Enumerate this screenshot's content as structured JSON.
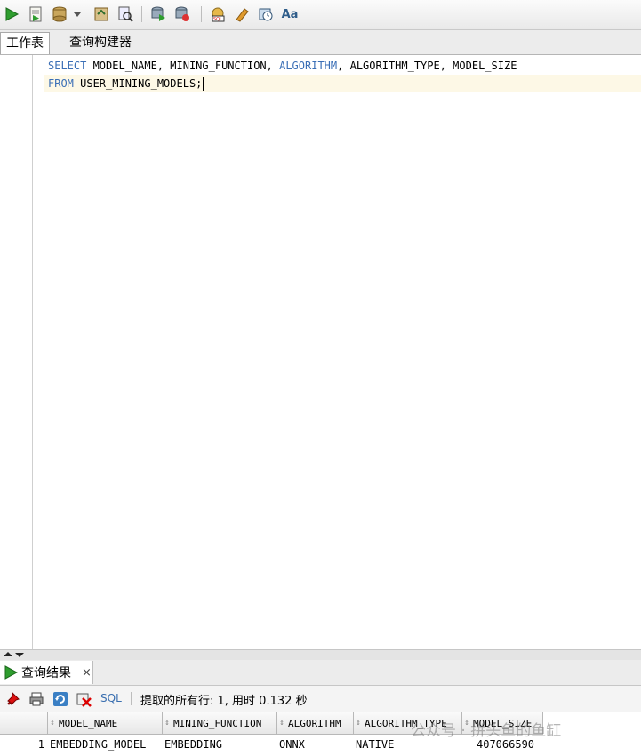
{
  "toolbar": {
    "buttons": [
      {
        "icon": "run-statement-icon"
      },
      {
        "icon": "run-script-icon"
      },
      {
        "icon": "commit-icon"
      },
      {
        "icon": "rollback-icon"
      },
      {
        "icon": "explain-plan-icon"
      },
      {
        "icon": "autotrace-icon"
      },
      {
        "icon": "sql-tuning-icon"
      },
      {
        "icon": "clear-icon"
      },
      {
        "icon": "history-icon"
      },
      {
        "icon": "format-case-icon"
      }
    ],
    "case_label": "Aa"
  },
  "editor_tabs": [
    {
      "label": "工作表"
    },
    {
      "label": "查询构建器"
    }
  ],
  "editor": {
    "line1": {
      "kw1": "SELECT",
      "t1": " MODEL_NAME, MINING_FUNCTION, ",
      "kw2": "ALGORITHM",
      "t2": ", ALGORITHM_TYPE, MODEL_SIZE"
    },
    "line2": {
      "kw1": "FROM",
      "t1": " USER_MINING_MODELS;"
    }
  },
  "results": {
    "tab_label": "查询结果",
    "close": "×",
    "sql_label": "SQL",
    "status": "提取的所有行: 1, 用时 0.132 秒",
    "columns": [
      "MODEL_NAME",
      "MINING_FUNCTION",
      "ALGORITHM",
      "ALGORITHM_TYPE",
      "MODEL_SIZE"
    ],
    "rows": [
      {
        "num": "1",
        "cells": [
          "EMBEDDING_MODEL",
          "EMBEDDING",
          "ONNX",
          "NATIVE",
          "407066590"
        ]
      }
    ]
  },
  "watermark": "公众号 · 拼头鱼的鱼缸",
  "colors": {
    "keyword": "#3b6fb6",
    "current_line": "#fdf8e6",
    "run_green": "#2e9d2e"
  }
}
